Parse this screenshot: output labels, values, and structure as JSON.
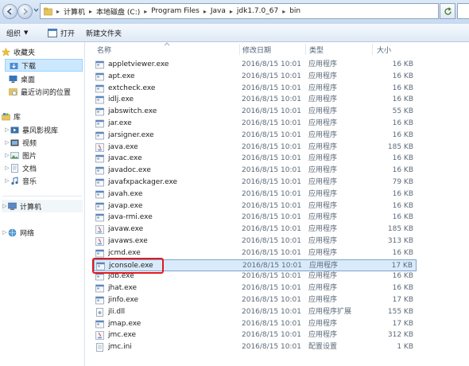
{
  "address_bar": {
    "segments": [
      "计算机",
      "本地磁盘 (C:)",
      "Program Files",
      "Java",
      "jdk1.7.0_67",
      "bin"
    ]
  },
  "toolbar": {
    "organize_label": "组织",
    "open_label": "打开",
    "new_folder_label": "新建文件夹"
  },
  "sidebar": {
    "favorites_label": "收藏夹",
    "favorites_items": [
      "下载",
      "桌面",
      "最近访问的位置"
    ],
    "libraries_label": "库",
    "libraries_items": [
      "暴风影视库",
      "视频",
      "图片",
      "文档",
      "音乐"
    ],
    "computer_label": "计算机",
    "network_label": "网络"
  },
  "columns": {
    "name": "名称",
    "date": "修改日期",
    "type": "类型",
    "size": "大小"
  },
  "files": [
    {
      "name": "appletviewer.exe",
      "date": "2016/8/15 10:01",
      "type": "应用程序",
      "size": "16 KB"
    },
    {
      "name": "apt.exe",
      "date": "2016/8/15 10:01",
      "type": "应用程序",
      "size": "16 KB"
    },
    {
      "name": "extcheck.exe",
      "date": "2016/8/15 10:01",
      "type": "应用程序",
      "size": "16 KB"
    },
    {
      "name": "idlj.exe",
      "date": "2016/8/15 10:01",
      "type": "应用程序",
      "size": "16 KB"
    },
    {
      "name": "jabswitch.exe",
      "date": "2016/8/15 10:01",
      "type": "应用程序",
      "size": "55 KB"
    },
    {
      "name": "jar.exe",
      "date": "2016/8/15 10:01",
      "type": "应用程序",
      "size": "16 KB"
    },
    {
      "name": "jarsigner.exe",
      "date": "2016/8/15 10:01",
      "type": "应用程序",
      "size": "16 KB"
    },
    {
      "name": "java.exe",
      "date": "2016/8/15 10:01",
      "type": "应用程序",
      "size": "185 KB"
    },
    {
      "name": "javac.exe",
      "date": "2016/8/15 10:01",
      "type": "应用程序",
      "size": "16 KB"
    },
    {
      "name": "javadoc.exe",
      "date": "2016/8/15 10:01",
      "type": "应用程序",
      "size": "16 KB"
    },
    {
      "name": "javafxpackager.exe",
      "date": "2016/8/15 10:01",
      "type": "应用程序",
      "size": "79 KB"
    },
    {
      "name": "javah.exe",
      "date": "2016/8/15 10:01",
      "type": "应用程序",
      "size": "16 KB"
    },
    {
      "name": "javap.exe",
      "date": "2016/8/15 10:01",
      "type": "应用程序",
      "size": "16 KB"
    },
    {
      "name": "java-rmi.exe",
      "date": "2016/8/15 10:01",
      "type": "应用程序",
      "size": "16 KB"
    },
    {
      "name": "javaw.exe",
      "date": "2016/8/15 10:01",
      "type": "应用程序",
      "size": "185 KB"
    },
    {
      "name": "javaws.exe",
      "date": "2016/8/15 10:01",
      "type": "应用程序",
      "size": "313 KB"
    },
    {
      "name": "jcmd.exe",
      "date": "2016/8/15 10:01",
      "type": "应用程序",
      "size": "16 KB"
    },
    {
      "name": "jconsole.exe",
      "date": "2016/8/15 10:01",
      "type": "应用程序",
      "size": "17 KB"
    },
    {
      "name": "jdb.exe",
      "date": "2016/8/15 10:01",
      "type": "应用程序",
      "size": "16 KB"
    },
    {
      "name": "jhat.exe",
      "date": "2016/8/15 10:01",
      "type": "应用程序",
      "size": "16 KB"
    },
    {
      "name": "jinfo.exe",
      "date": "2016/8/15 10:01",
      "type": "应用程序",
      "size": "17 KB"
    },
    {
      "name": "jli.dll",
      "date": "2016/8/15 10:01",
      "type": "应用程序扩展",
      "size": "155 KB"
    },
    {
      "name": "jmap.exe",
      "date": "2016/8/15 10:01",
      "type": "应用程序",
      "size": "17 KB"
    },
    {
      "name": "jmc.exe",
      "date": "2016/8/15 10:01",
      "type": "应用程序",
      "size": "312 KB"
    },
    {
      "name": "jmc.ini",
      "date": "2016/8/15 10:01",
      "type": "配置设置",
      "size": "1 KB"
    }
  ],
  "selected_file": "jconsole.exe",
  "colors": {
    "highlight_box": "#e0191c",
    "selection_bg": "#d9ebfb"
  }
}
